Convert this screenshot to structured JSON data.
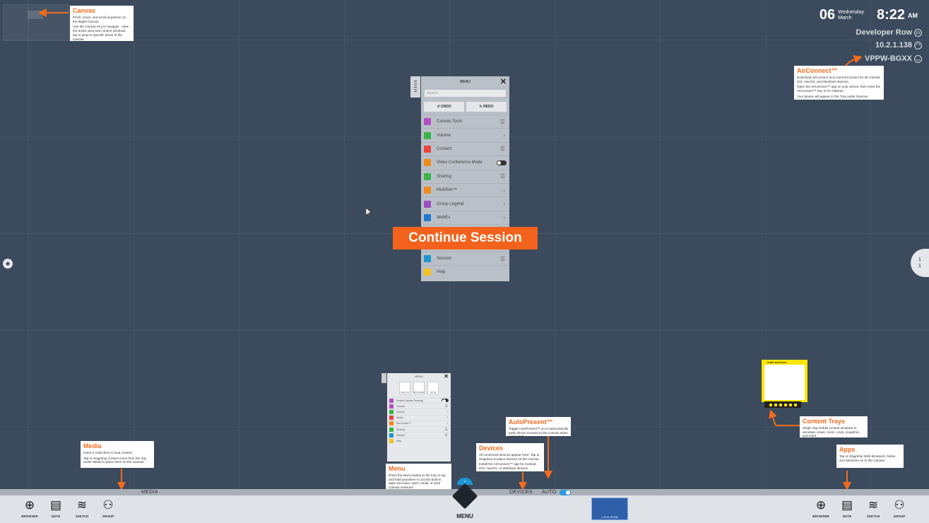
{
  "colors": {
    "accent": "#f26b1d",
    "canvas": "#3b4a5c",
    "tray": "#dfe2e6",
    "auto_toggle": "#2d9be0"
  },
  "clock": {
    "day": "06",
    "weekday": "Wednesday",
    "month": "March",
    "time": "8:22",
    "ampm": "AM"
  },
  "status": {
    "room_name": "Developer Row",
    "ip": "10.2.1.138",
    "key": "VPPW-BGXX"
  },
  "callouts": {
    "canvas": {
      "title": "Canvas",
      "p1": "Pinch, zoom, and scroll anywhere on the digital Canvas.",
      "p2": "Use the Canvas Key to navigate - view the active area and content windows; tap to jump to specific areas of the Canvas."
    },
    "airconnect": {
      "title": "AirConnect™",
      "p1": "Download AirConnect at tv.com/AirConnect for all Android, iOS, macOS, and Windows devices.",
      "p2": "Open the AirConnect™ app on your device, then enter the AirConnect™ Key or IP Address.",
      "p3": "Your device will appear in the Tray under Devices."
    },
    "media": {
      "title": "Media",
      "p1": "Insert a USB drive to load content.",
      "p2": "Tap or drag/drop content icons from the tray under Media to place them on the Canvas."
    },
    "menu": {
      "title": "Menu",
      "p1": "Press the Menu button in the tray or tap and hold anywhere to access built-in apps and save, open, email, or print Canvas sessions."
    },
    "devices": {
      "title": "Devices",
      "p1": "All connected devices appear here. Tap or drag/drop to place devices on the Canvas.",
      "p2": "Install the AirConnect™ app for Android, iOS, macOS, or Windows devices."
    },
    "autopresent": {
      "title": "AutoPresent™",
      "p1": "Toggle AutoPresent™ on to automatically push device screens to the Canvas when connected."
    },
    "content_trays": {
      "title": "Content Trays",
      "p1": "Single Tap mobile content windows to annotate, erase, zoom, undo, snapshot, and more."
    },
    "apps": {
      "title": "Apps",
      "p1": "Tap or drag/drop Web Browsers, Notes, and Sketches on to the Canvas."
    }
  },
  "menu_panel": {
    "title": "MENU",
    "search_placeholder": "Search",
    "undo": "UNDO",
    "redo": "REDO",
    "items": [
      {
        "label": "Canvas Tools",
        "color": "#b04fc2",
        "right": "☰"
      },
      {
        "label": "Volume",
        "color": "#3bb54a",
        "right": "›"
      },
      {
        "label": "Content",
        "color": "#e8443a",
        "right": "☰"
      },
      {
        "label": "Video Conference Mode",
        "color": "#f08a1c",
        "right": "toggle"
      },
      {
        "label": "Sharing",
        "color": "#3bb54a",
        "right": "☰"
      },
      {
        "label": "MultiSite™",
        "color": "#f08a1c",
        "right": "›"
      },
      {
        "label": "Group Legend",
        "color": "#9b4fc2",
        "right": "›"
      },
      {
        "label": "WebEx",
        "color": "#1e7bd1",
        "right": "›"
      },
      {
        "label": "",
        "color": "#4a4f57",
        "right": ""
      },
      {
        "label": "",
        "color": "#4a4f57",
        "right": ""
      },
      {
        "label": "Session",
        "color": "#1e96d1",
        "right": "☰"
      },
      {
        "label": "Help",
        "color": "#f2c21c",
        "right": ""
      }
    ]
  },
  "continue_session": "Continue Session",
  "mini_menu": {
    "title": "MENU",
    "apps": [
      "SKETCH",
      "BROWSER",
      "NOTE"
    ],
    "rows": [
      {
        "label": "Enable Canvas Drawing",
        "color": "#b04fc2",
        "right": "toggle"
      },
      {
        "label": "Canvas",
        "color": "#b04fc2",
        "right": "☰"
      },
      {
        "label": "Volume",
        "color": "#3bb54a",
        "right": "›"
      },
      {
        "label": "Media",
        "color": "#e8443a",
        "right": "›"
      },
      {
        "label": "AirConnect™",
        "color": "#f08a1c",
        "right": "›"
      },
      {
        "label": "Sharing",
        "color": "#3bb54a",
        "right": "☰"
      },
      {
        "label": "Session",
        "color": "#1e96d1",
        "right": "☰"
      },
      {
        "label": "Help",
        "color": "#f2c21c",
        "right": ""
      }
    ]
  },
  "note_app": {
    "title": "enter text here"
  },
  "tray": {
    "media_label": "MEDIA",
    "devices_label": "DEVICES",
    "auto_label": "AUTO",
    "menu_label": "MENU",
    "local_room_label": "LOCAL ROOM",
    "left_buttons": [
      {
        "label": "BROWSER",
        "icon": "globe-icon",
        "glyph": "⊕"
      },
      {
        "label": "NOTE",
        "icon": "note-icon",
        "glyph": "▤"
      },
      {
        "label": "SKETCH",
        "icon": "sketch-icon",
        "glyph": "≋"
      },
      {
        "label": "GROUP",
        "icon": "group-icon",
        "glyph": "⚇"
      }
    ],
    "right_buttons": [
      {
        "label": "BROWSER",
        "icon": "globe-icon",
        "glyph": "⊕"
      },
      {
        "label": "NOTE",
        "icon": "note-icon",
        "glyph": "▤"
      },
      {
        "label": "SKETCH",
        "icon": "sketch-icon",
        "glyph": "≋"
      },
      {
        "label": "GROUP",
        "icon": "group-icon",
        "glyph": "⚇"
      }
    ]
  },
  "side_handles": {
    "left_glyph": "◉",
    "right_top": "1",
    "right_bottom": "1"
  }
}
